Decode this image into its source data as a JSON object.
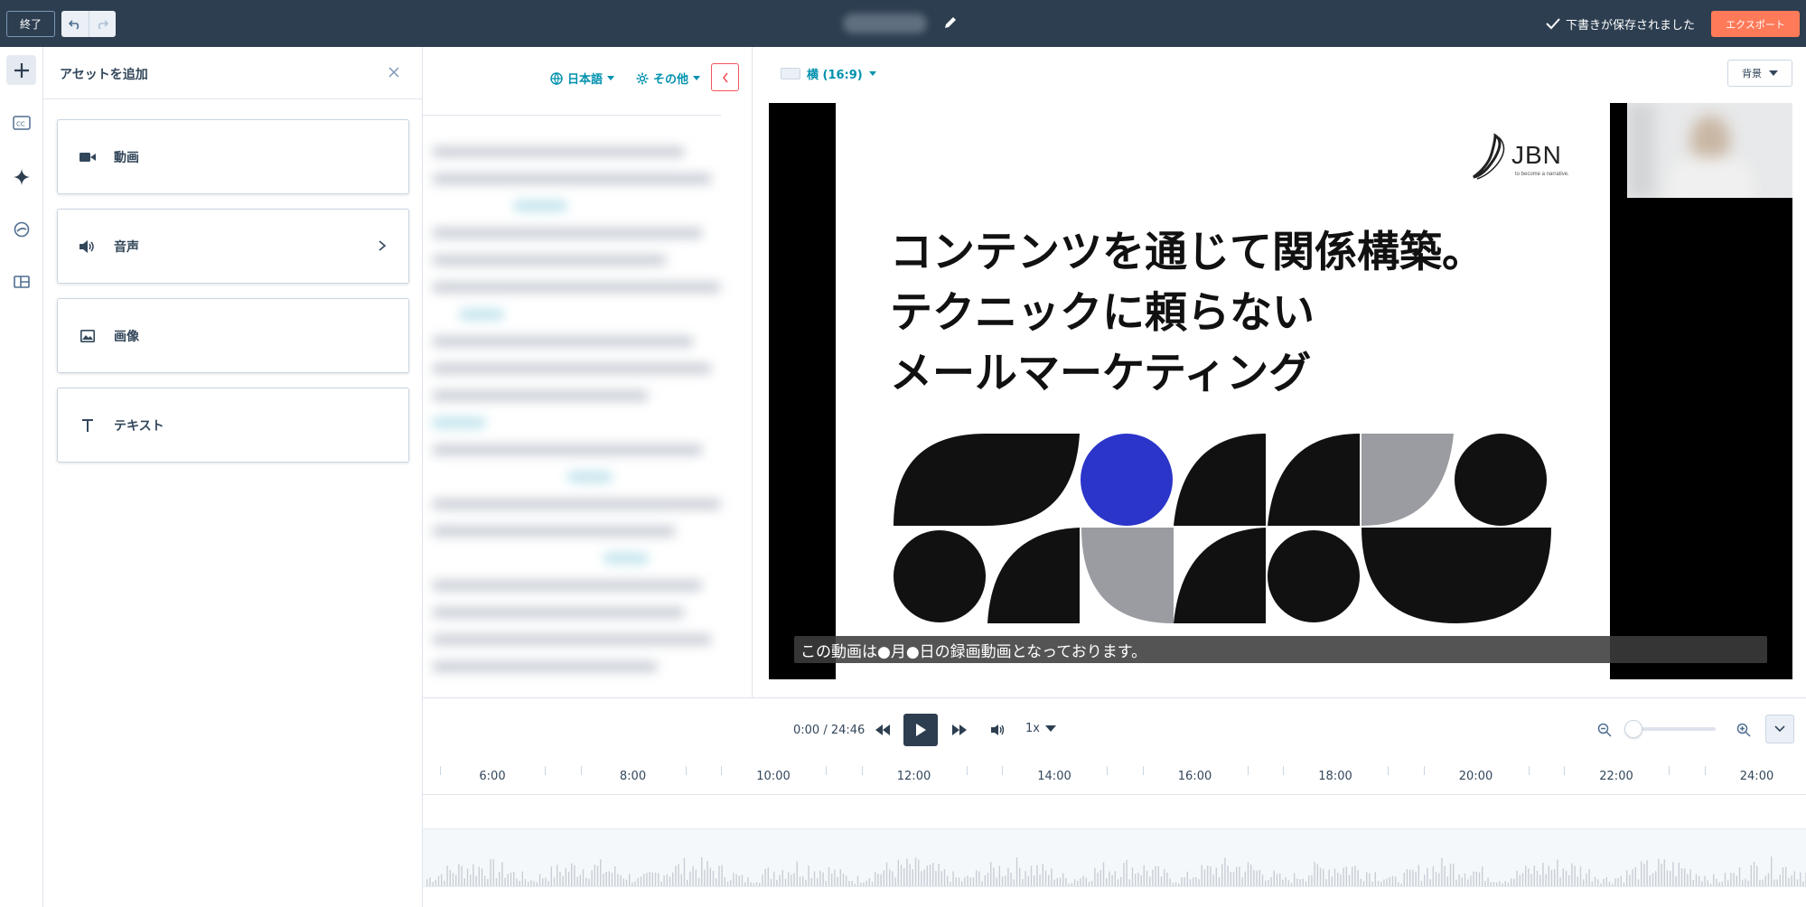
{
  "topbar": {
    "exit_label": "終了",
    "saved_text": "下書きが保存されました",
    "export_label": "エクスポート"
  },
  "rail": {
    "items": [
      "plus-icon",
      "closed-caption-icon",
      "sparkle-icon",
      "sticker-icon",
      "layout-icon"
    ]
  },
  "asset_panel": {
    "title": "アセットを追加",
    "items": [
      {
        "label": "動画",
        "icon": "video-camera-icon"
      },
      {
        "label": "音声",
        "icon": "speaker-icon"
      },
      {
        "label": "画像",
        "icon": "image-icon"
      },
      {
        "label": "テキスト",
        "icon": "text-icon"
      }
    ]
  },
  "transcript": {
    "language_label": "日本語",
    "other_label": "その他"
  },
  "preview": {
    "aspect_label": "横 (16:9)",
    "background_label": "背景",
    "slide": {
      "logo_text": "JBN",
      "logo_tagline": "to become a narrative.",
      "headline_lines": [
        "コンテンツを通じて関係構築。",
        "テクニックに頼らない",
        "メールマーケティング"
      ]
    },
    "caption": "この動画は●月●日の録画動画となっております。"
  },
  "playback": {
    "time": "0:00 / 24:46",
    "speed": "1x",
    "zoom_level": 0
  },
  "timeline": {
    "ticks": [
      "6:00",
      "8:00",
      "10:00",
      "12:00",
      "14:00",
      "16:00",
      "18:00",
      "20:00",
      "22:00",
      "24:00"
    ]
  },
  "colors": {
    "topbar": "#2d3e50",
    "accent": "#0091ae",
    "export": "#ff7a59",
    "slide_blue": "#2b35c9",
    "slide_gray": "#9a9ca1"
  }
}
